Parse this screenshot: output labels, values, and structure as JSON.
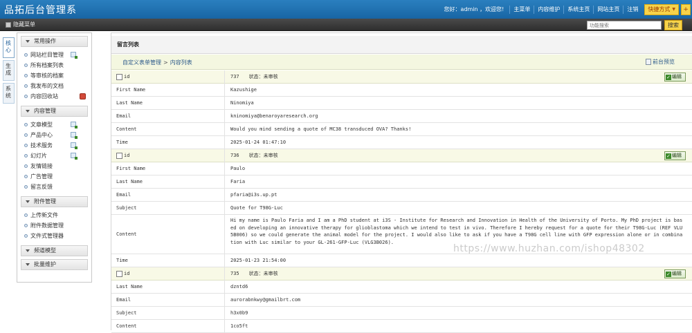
{
  "app": {
    "title": "品拓后台管理系"
  },
  "header": {
    "welcome": "您好：admin ，欢迎您!",
    "links": [
      "主菜单",
      "内容维护",
      "系统主页",
      "网站主页",
      "注销"
    ],
    "quick_label": "快捷方式",
    "plus_label": "+"
  },
  "subbar": {
    "hide_menu": "隐藏菜单",
    "search_placeholder": "功能搜索",
    "search_button": "搜索"
  },
  "vtabs": [
    "核心",
    "生成",
    "系统"
  ],
  "sidebar": {
    "groups": [
      {
        "title": "常用操作",
        "items": [
          "网站栏目管理",
          "所有档案列表",
          "等审核的档案",
          "我发布的文档",
          "内容回收站"
        ]
      },
      {
        "title": "内容管理",
        "items": [
          "文章模型",
          "产品中心",
          "技术服务",
          "幻灯片",
          "友情链接",
          "广告管理",
          "留言反馈"
        ]
      },
      {
        "title": "附件管理",
        "items": [
          "上传新文件",
          "附件数据管理",
          "文件式管理器"
        ]
      },
      {
        "title": "频道模型",
        "items": []
      },
      {
        "title": "批量维护",
        "items": []
      }
    ]
  },
  "main": {
    "panel_title": "留言列表",
    "breadcrumb": {
      "parent": "自定义表单管理",
      "separator": ">",
      "current": "内容列表"
    },
    "preview_label": "前台预览",
    "edit_label": "编辑",
    "id_label": "id",
    "records": [
      {
        "id": "737",
        "status": "状态：未审核",
        "fields": [
          {
            "label": "First Name",
            "value": "Kazushige"
          },
          {
            "label": "Last Name",
            "value": "Ninomiya"
          },
          {
            "label": "Email",
            "value": "kninomiya@benaroyaresearch.org"
          },
          {
            "label": "Content",
            "value": "Would you mind sending a quote of MC38 transduced OVA? Thanks!"
          },
          {
            "label": "Time",
            "value": "2025-01-24 01:47:10"
          }
        ]
      },
      {
        "id": "736",
        "status": "状态：未审核",
        "fields": [
          {
            "label": "First Name",
            "value": "Paulo"
          },
          {
            "label": "Last Name",
            "value": "Faria"
          },
          {
            "label": "Email",
            "value": "pfaria@i3s.up.pt"
          },
          {
            "label": "Subject",
            "value": "Quote for T98G-Luc"
          },
          {
            "label": "Content",
            "value": "Hi my name is Paulo Faria and I am a PhD student at i3S - Institute for Research and Innovation in Health of the University of Porto. My PhD project is based on developing an innovative therapy for glioblastoma which we intend to test in vivo. Therefore I hereby request for a quote for their T98G-Luc (REF VLU5B006) so we could generate the animal model for the project. I would also like to ask if you have a T98G cell line with GFP expression alone or in combination with Luc similar to your GL-261-GFP-Luc (VLG3B026)."
          },
          {
            "label": "Time",
            "value": "2025-01-23 21:54:00"
          }
        ]
      },
      {
        "id": "735",
        "status": "状态：未审核",
        "fields": [
          {
            "label": "Last Name",
            "value": "dzntd6"
          },
          {
            "label": "Email",
            "value": "aurorabnkwy@gmailbrt.com"
          },
          {
            "label": "Subject",
            "value": "h3x0b9"
          },
          {
            "label": "Content",
            "value": "1co5ft"
          }
        ]
      }
    ]
  },
  "watermark": "https://www.huzhan.com/ishop48302"
}
